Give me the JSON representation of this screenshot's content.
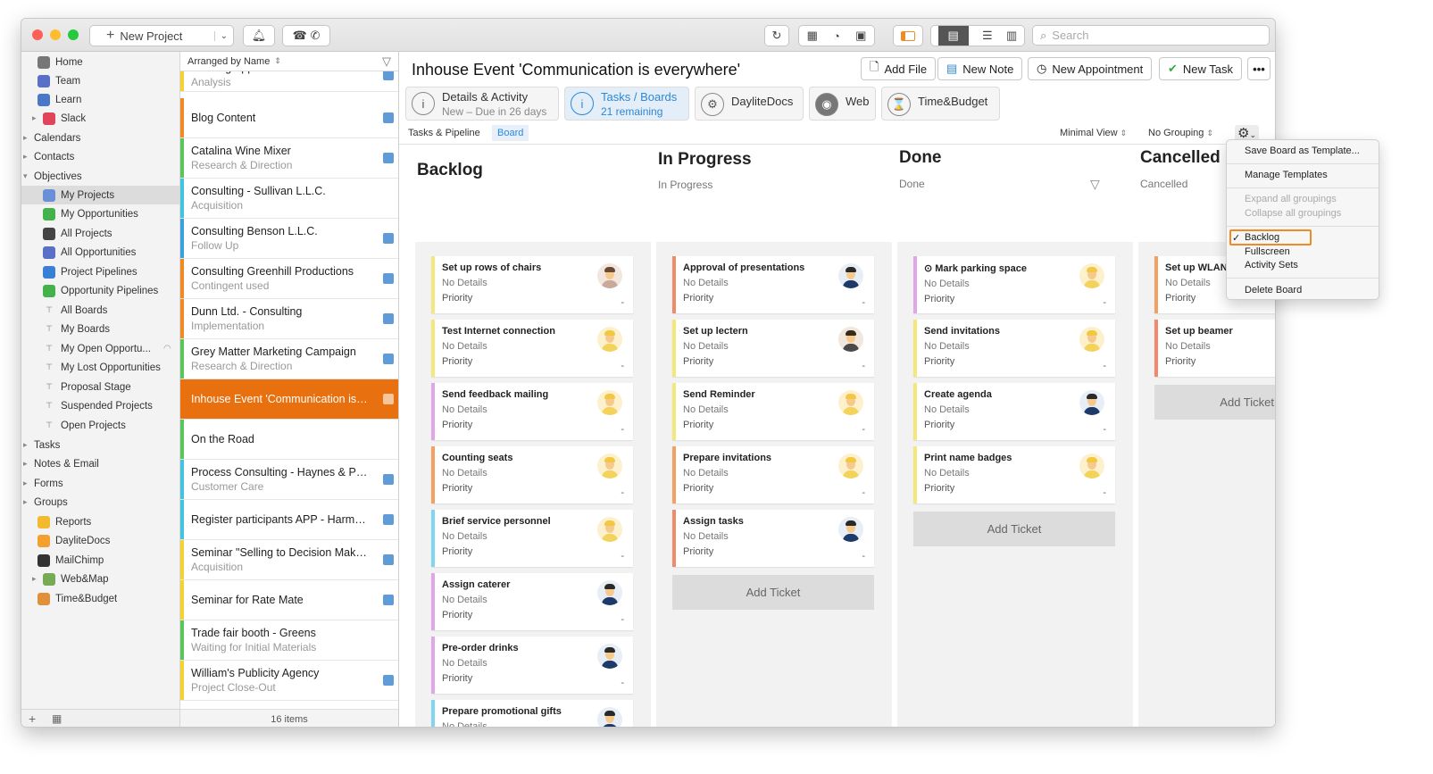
{
  "toolbar": {
    "new_project": "New Project",
    "search_placeholder": "Search"
  },
  "sidebar": {
    "items": [
      {
        "label": "Home",
        "icon": "home-icon"
      },
      {
        "label": "Team",
        "icon": "team-icon"
      },
      {
        "label": "Learn",
        "icon": "learn-icon"
      },
      {
        "label": "Slack",
        "icon": "slack-icon"
      },
      {
        "label": "Calendars",
        "icon": ""
      },
      {
        "label": "Contacts",
        "icon": ""
      },
      {
        "label": "Objectives",
        "icon": ""
      },
      {
        "label": "My Projects",
        "icon": "projects-icon"
      },
      {
        "label": "My Opportunities",
        "icon": "opportunities-icon"
      },
      {
        "label": "All Projects",
        "icon": "projects-icon"
      },
      {
        "label": "All Opportunities",
        "icon": "opportunities-icon"
      },
      {
        "label": "Project Pipelines",
        "icon": "pipeline-icon"
      },
      {
        "label": "Opportunity Pipelines",
        "icon": "pipeline-icon"
      },
      {
        "label": "All Boards",
        "icon": "board-icon"
      },
      {
        "label": "My Boards",
        "icon": "board-icon"
      },
      {
        "label": "My Open Opportu...",
        "icon": "smart-list-icon"
      },
      {
        "label": "My Lost Opportunities",
        "icon": "smart-list-icon"
      },
      {
        "label": "Proposal Stage",
        "icon": "smart-list-icon"
      },
      {
        "label": "Suspended Projects",
        "icon": "board-icon"
      },
      {
        "label": "Open Projects",
        "icon": "board-icon"
      },
      {
        "label": "Tasks",
        "icon": ""
      },
      {
        "label": "Notes & Email",
        "icon": ""
      },
      {
        "label": "Forms",
        "icon": ""
      },
      {
        "label": "Groups",
        "icon": ""
      },
      {
        "label": "Reports",
        "icon": "reports-icon"
      },
      {
        "label": "DayliteDocs",
        "icon": "docs-icon"
      },
      {
        "label": "MailChimp",
        "icon": "mailchimp-icon"
      },
      {
        "label": "Web&Map",
        "icon": "webmap-icon"
      },
      {
        "label": "Time&Budget",
        "icon": "timebudget-icon"
      }
    ]
  },
  "list": {
    "header": "Arranged by Name",
    "footer": "16 items",
    "items": [
      {
        "title": "Banking App Bush Inc.",
        "sub": "Analysis",
        "color": "#f3d232"
      },
      {
        "title": "Blog Content",
        "sub": "",
        "color": "#f08a24"
      },
      {
        "title": "Catalina Wine Mixer",
        "sub": "Research & Direction",
        "color": "#5ac55a"
      },
      {
        "title": "Consulting - Sullivan L.L.C.",
        "sub": "Acquisition",
        "color": "#43c3e0"
      },
      {
        "title": "Consulting Benson L.L.C.",
        "sub": "Follow Up",
        "color": "#3aa0e0"
      },
      {
        "title": "Consulting Greenhill Productions",
        "sub": "Contingent used",
        "color": "#f08a24"
      },
      {
        "title": "Dunn Ltd. - Consulting",
        "sub": "Implementation",
        "color": "#f08a24"
      },
      {
        "title": "Grey Matter Marketing Campaign",
        "sub": "Research & Direction",
        "color": "#5ac55a"
      },
      {
        "title": "Inhouse Event 'Communication is e...",
        "sub": "",
        "color": "#e8700f"
      },
      {
        "title": "On the Road",
        "sub": "",
        "color": "#5ac55a"
      },
      {
        "title": "Process Consulting - Haynes & Par...",
        "sub": "Customer Care",
        "color": "#43c3e0"
      },
      {
        "title": "Register participants APP - Harmo...",
        "sub": "",
        "color": "#43c3e0"
      },
      {
        "title": "Seminar \"Selling to Decision Maker...",
        "sub": "Acquisition",
        "color": "#f3d232"
      },
      {
        "title": "Seminar for Rate Mate",
        "sub": "",
        "color": "#f3d232"
      },
      {
        "title": "Trade fair booth - Greens",
        "sub": "Waiting for Initial Materials",
        "color": "#5ac55a"
      },
      {
        "title": "William's Publicity Agency",
        "sub": "Project Close-Out",
        "color": "#f3d232"
      }
    ]
  },
  "main": {
    "title": "Inhouse Event 'Communication is everywhere'",
    "actions": {
      "add_file": "Add File",
      "new_note": "New Note",
      "new_appointment": "New Appointment",
      "new_task": "New Task"
    },
    "tabs": [
      {
        "title": "Details & Activity",
        "sub": "New – Due in 26 days"
      },
      {
        "title": "Tasks / Boards",
        "sub": "21 remaining"
      },
      {
        "title": "DayliteDocs",
        "sub": ""
      },
      {
        "title": "Web",
        "sub": ""
      },
      {
        "title": "Time&Budget",
        "sub": ""
      }
    ],
    "subtabs": {
      "pipeline": "Tasks & Pipeline",
      "board": "Board"
    },
    "view_select": "Minimal View",
    "grouping_select": "No Grouping"
  },
  "board": {
    "add_ticket": "Add Ticket",
    "details_label": "No Details",
    "priority_label": "Priority",
    "priority_value": "-",
    "columns": [
      {
        "title": "Backlog",
        "sub": "",
        "cards": [
          {
            "title": "Set up rows of chairs",
            "color": "#f5e87a",
            "avatar": "woman"
          },
          {
            "title": "Test Internet connection",
            "color": "#f5e87a",
            "avatar": "blonde"
          },
          {
            "title": "Send feedback mailing",
            "color": "#e0a6e8",
            "avatar": "blonde"
          },
          {
            "title": "Counting seats",
            "color": "#f3a060",
            "avatar": "blonde"
          },
          {
            "title": "Brief service personnel",
            "color": "#7fd6ee",
            "avatar": "blonde"
          },
          {
            "title": "Assign caterer",
            "color": "#e0a6e8",
            "avatar": "man"
          },
          {
            "title": "Pre-order drinks",
            "color": "#e0a6e8",
            "avatar": "man"
          },
          {
            "title": "Prepare promotional gifts",
            "color": "#7fd6ee",
            "avatar": "man"
          }
        ]
      },
      {
        "title": "In Progress",
        "sub": "In Progress",
        "cards": [
          {
            "title": "Approval of presentations",
            "color": "#f08a6a",
            "avatar": "man"
          },
          {
            "title": "Set up lectern",
            "color": "#f5e87a",
            "avatar": "glasses"
          },
          {
            "title": "Send Reminder",
            "color": "#f5e87a",
            "avatar": "blonde"
          },
          {
            "title": "Prepare invitations",
            "color": "#f3a060",
            "avatar": "blonde"
          },
          {
            "title": "Assign tasks",
            "color": "#f08a6a",
            "avatar": "man"
          }
        ]
      },
      {
        "title": "Done",
        "sub": "Done",
        "cards": [
          {
            "title": "⊙ Mark parking space",
            "color": "#e0a6e8",
            "avatar": "blonde"
          },
          {
            "title": "Send invitations",
            "color": "#f5e87a",
            "avatar": "blonde"
          },
          {
            "title": "Create agenda",
            "color": "#f5e87a",
            "avatar": "man"
          },
          {
            "title": "Print name badges",
            "color": "#f5e87a",
            "avatar": "blonde"
          }
        ]
      },
      {
        "title": "Cancelled",
        "sub": "Cancelled",
        "cards": [
          {
            "title": "Set up WLAN",
            "color": "#f3a060",
            "avatar": ""
          },
          {
            "title": "Set up beamer",
            "color": "#f08a6a",
            "avatar": ""
          }
        ]
      }
    ]
  },
  "menu": {
    "save_template": "Save Board as Template...",
    "manage_templates": "Manage Templates",
    "expand_all": "Expand all groupings",
    "collapse_all": "Collapse all groupings",
    "backlog": "Backlog",
    "fullscreen": "Fullscreen",
    "activity_sets": "Activity Sets",
    "delete_board": "Delete Board",
    "checkmark": "✓"
  }
}
